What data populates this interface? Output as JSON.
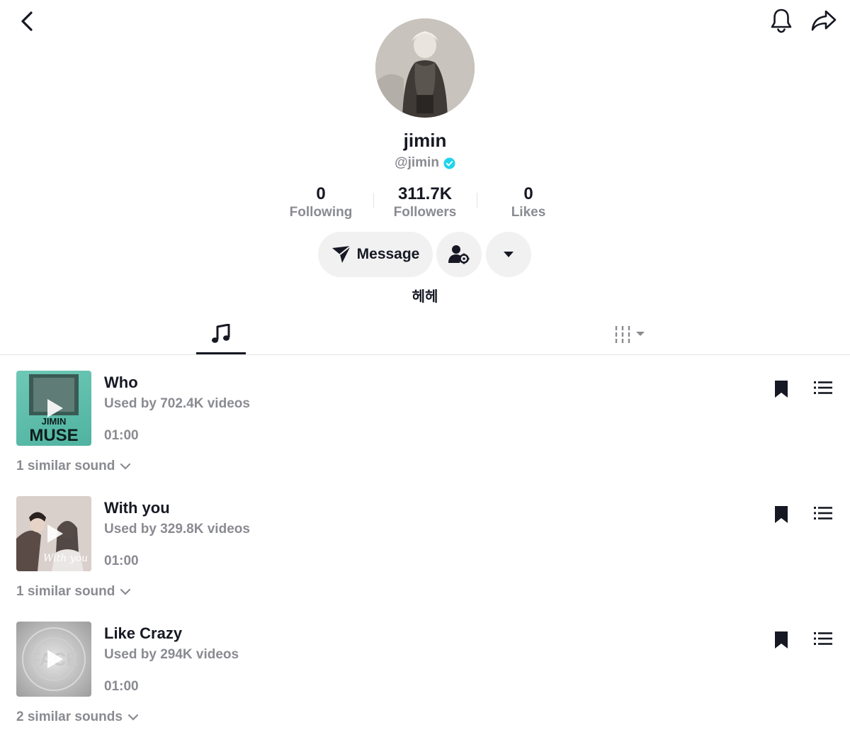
{
  "header": {
    "back_icon": "chevron-left-icon",
    "notification_icon": "bell-icon",
    "share_icon": "share-arrow-icon"
  },
  "profile": {
    "display_name": "jimin",
    "handle": "@jimin",
    "verified_color": "#20d5ec",
    "stats": [
      {
        "value": "0",
        "label": "Following"
      },
      {
        "value": "311.7K",
        "label": "Followers"
      },
      {
        "value": "0",
        "label": "Likes"
      }
    ],
    "message_label": "Message",
    "bio": "헤헤"
  },
  "tabs": {
    "music_icon": "music-note-icon",
    "filter_icon": "sliders-dropdown-icon"
  },
  "sounds": [
    {
      "title": "Who",
      "usage": "Used by 702.4K videos",
      "duration": "01:00",
      "similar": "1 similar sound",
      "cover_text": "MUSE",
      "cover_sub": "JIMIN"
    },
    {
      "title": "With you",
      "usage": "Used by 329.8K videos",
      "duration": "01:00",
      "similar": "1 similar sound",
      "cover_text": "With you"
    },
    {
      "title": "Like Crazy",
      "usage": "Used by 294K videos",
      "duration": "01:00",
      "similar": "2 similar sounds",
      "cover_text": "FACE"
    }
  ]
}
